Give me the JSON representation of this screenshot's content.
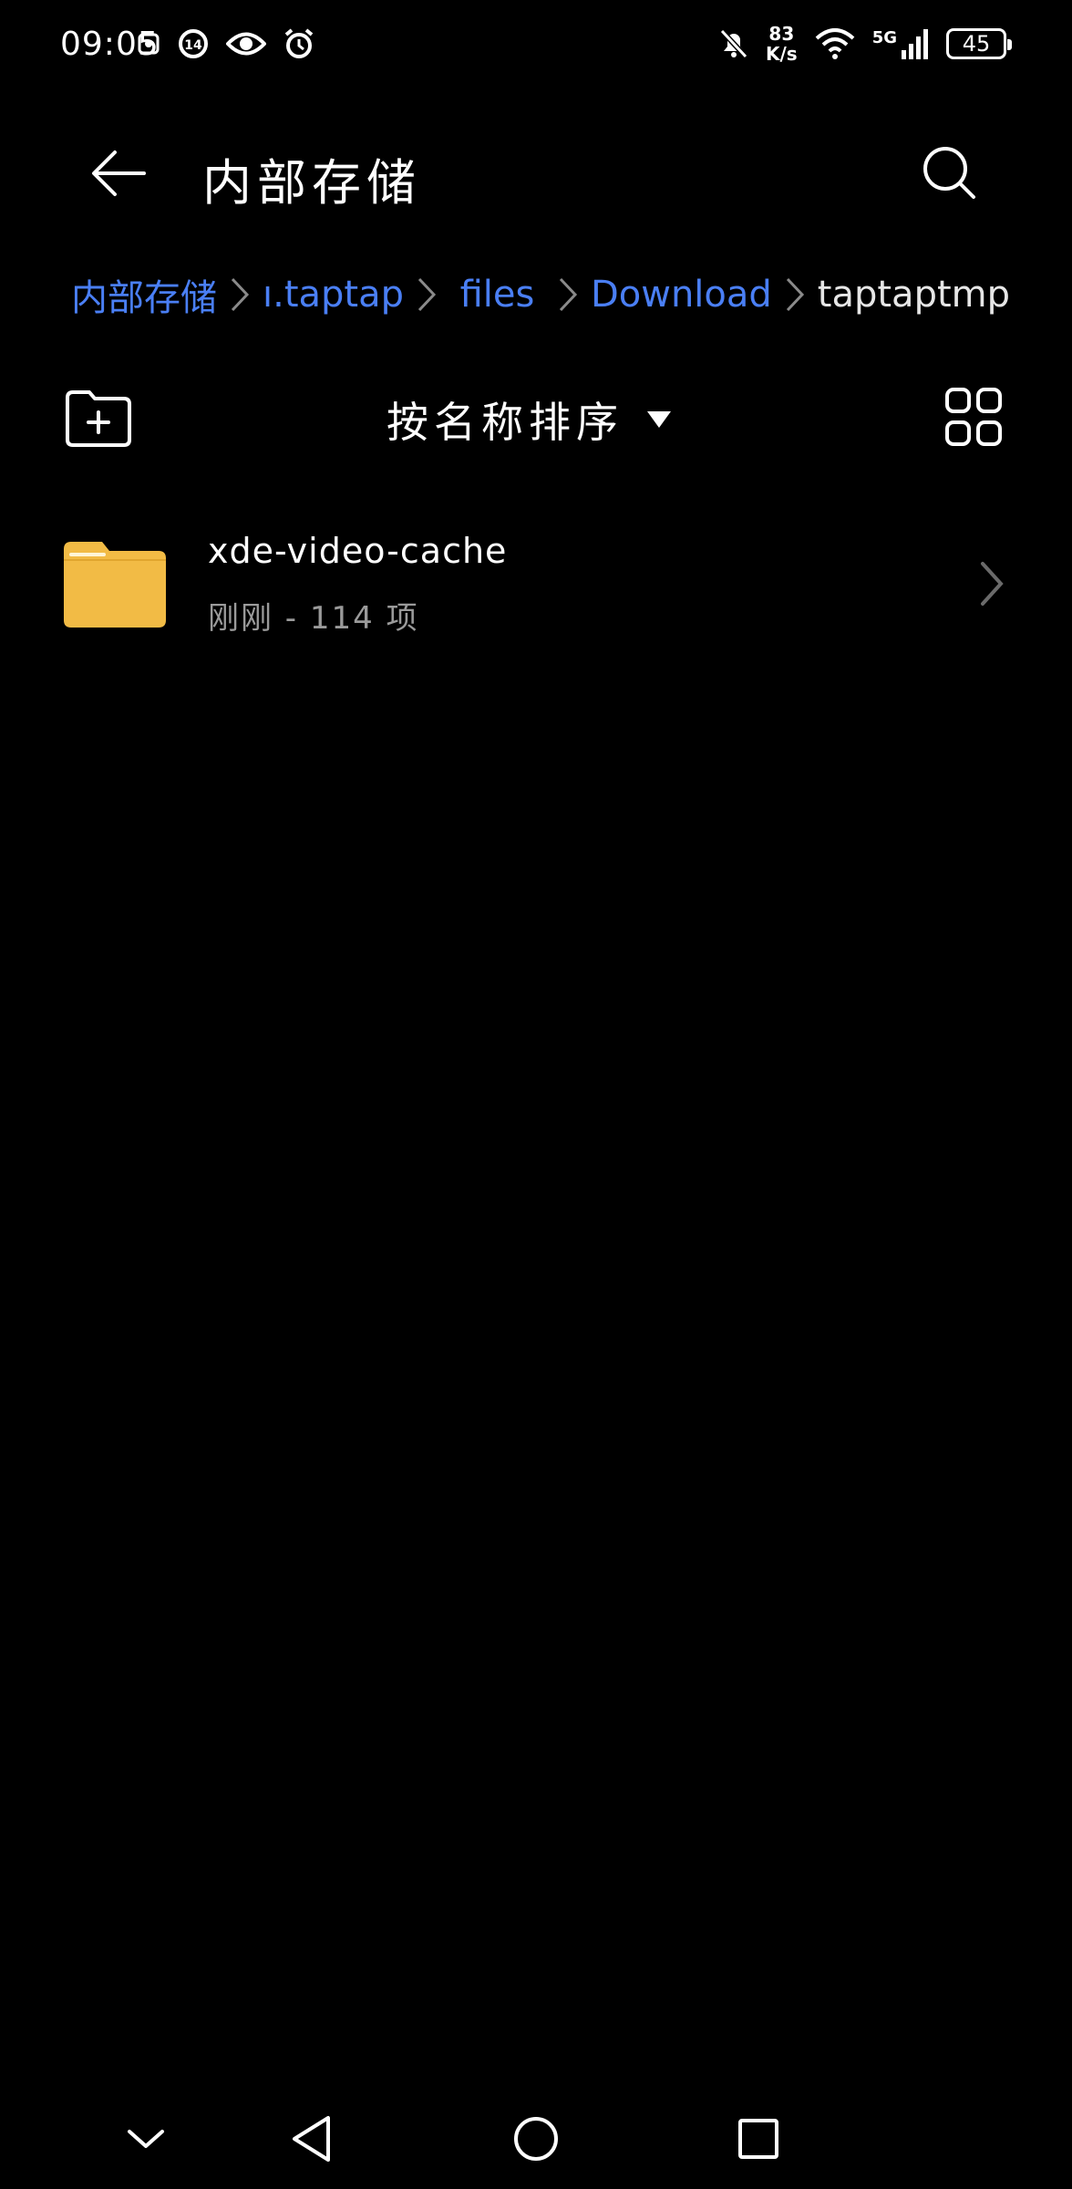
{
  "status_bar": {
    "time": "09:05",
    "speed_value": "83",
    "speed_unit": "K/s",
    "network": "5G",
    "battery": "45"
  },
  "header": {
    "title": "内部存储"
  },
  "breadcrumb": [
    {
      "label": "内部存储",
      "current": false
    },
    {
      "label": "ı.taptap",
      "current": false
    },
    {
      "label": "files",
      "current": false
    },
    {
      "label": "Download",
      "current": false
    },
    {
      "label": "taptaptmp",
      "current": true
    }
  ],
  "toolbar": {
    "sort_label": "按名称排序"
  },
  "files": [
    {
      "name": "xde-video-cache",
      "meta": "刚刚 - 114 项",
      "type": "folder"
    }
  ],
  "colors": {
    "background": "#000000",
    "accent": "#4a7ff5",
    "folder": "#f2bb45",
    "secondary_text": "#9a9a9a"
  },
  "icons": {
    "back": "arrow-left-icon",
    "search": "search-icon",
    "new_folder": "new-folder-icon",
    "sort_dropdown": "caret-down-icon",
    "view_toggle": "grid-view-icon",
    "folder": "folder-icon",
    "row_chevron": "chevron-right-icon"
  }
}
